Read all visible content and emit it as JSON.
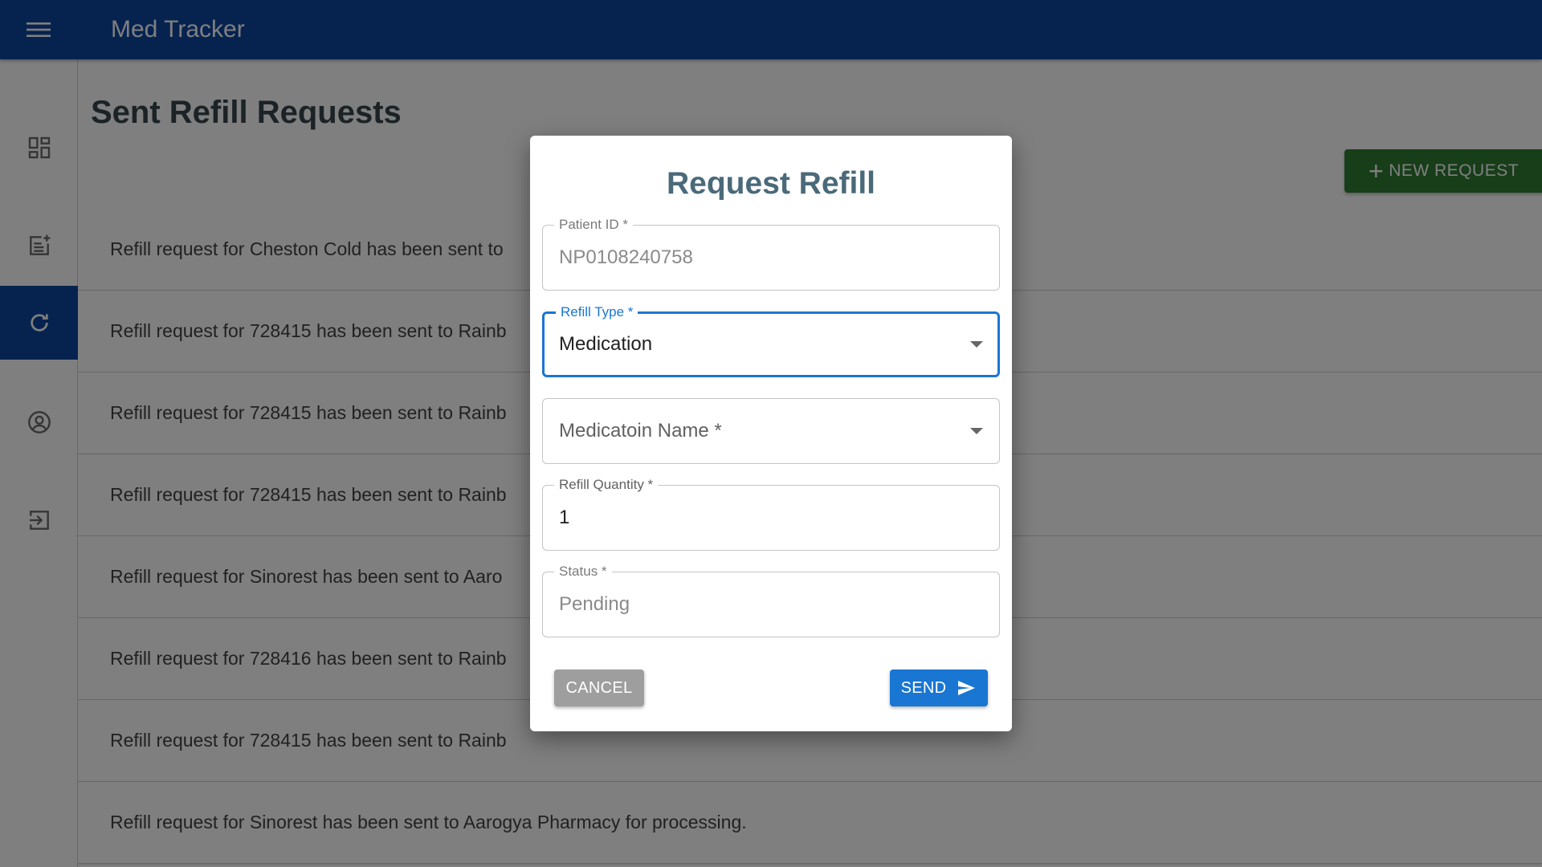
{
  "app": {
    "title": "Med Tracker",
    "menu_icon": "menu-icon"
  },
  "sidebar": {
    "items": [
      {
        "name": "dashboard",
        "icon": "dashboard-icon",
        "active": false
      },
      {
        "name": "new-note",
        "icon": "note-add-icon",
        "active": false
      },
      {
        "name": "refills",
        "icon": "refresh-icon",
        "active": true
      },
      {
        "name": "profile",
        "icon": "account-circle-icon",
        "active": false
      },
      {
        "name": "logout",
        "icon": "logout-icon",
        "active": false
      }
    ]
  },
  "main": {
    "title": "Sent Refill Requests",
    "new_request_label": "NEW REQUEST",
    "requests": [
      "Refill request for Cheston Cold has been sent to",
      "Refill request for 728415 has been sent to Rainb",
      "Refill request for 728415 has been sent to Rainb",
      "Refill request for 728415 has been sent to Rainb",
      "Refill request for Sinorest has been sent to Aaro",
      "Refill request for 728416 has been sent to Rainb",
      "Refill request for 728415 has been sent to Rainb",
      "Refill request for Sinorest has been sent to Aarogya Pharmacy for processing."
    ]
  },
  "dialog": {
    "title": "Request Refill",
    "patient_id": {
      "label": "Patient ID *",
      "value": "NP0108240758"
    },
    "refill_type": {
      "label": "Refill Type  *",
      "value": "Medication"
    },
    "medication_name": {
      "placeholder": "Medicatoin Name *"
    },
    "refill_quantity": {
      "label": "Refill Quantity *",
      "value": "1"
    },
    "status": {
      "label": "Status *",
      "value": "Pending"
    },
    "cancel_label": "CANCEL",
    "send_label": "SEND"
  },
  "colors": {
    "appbar": "#0d47a1",
    "new_request_button": "#2e7d32",
    "send_button": "#1976d2",
    "cancel_button": "#9e9e9e",
    "focus": "#1976d2"
  }
}
